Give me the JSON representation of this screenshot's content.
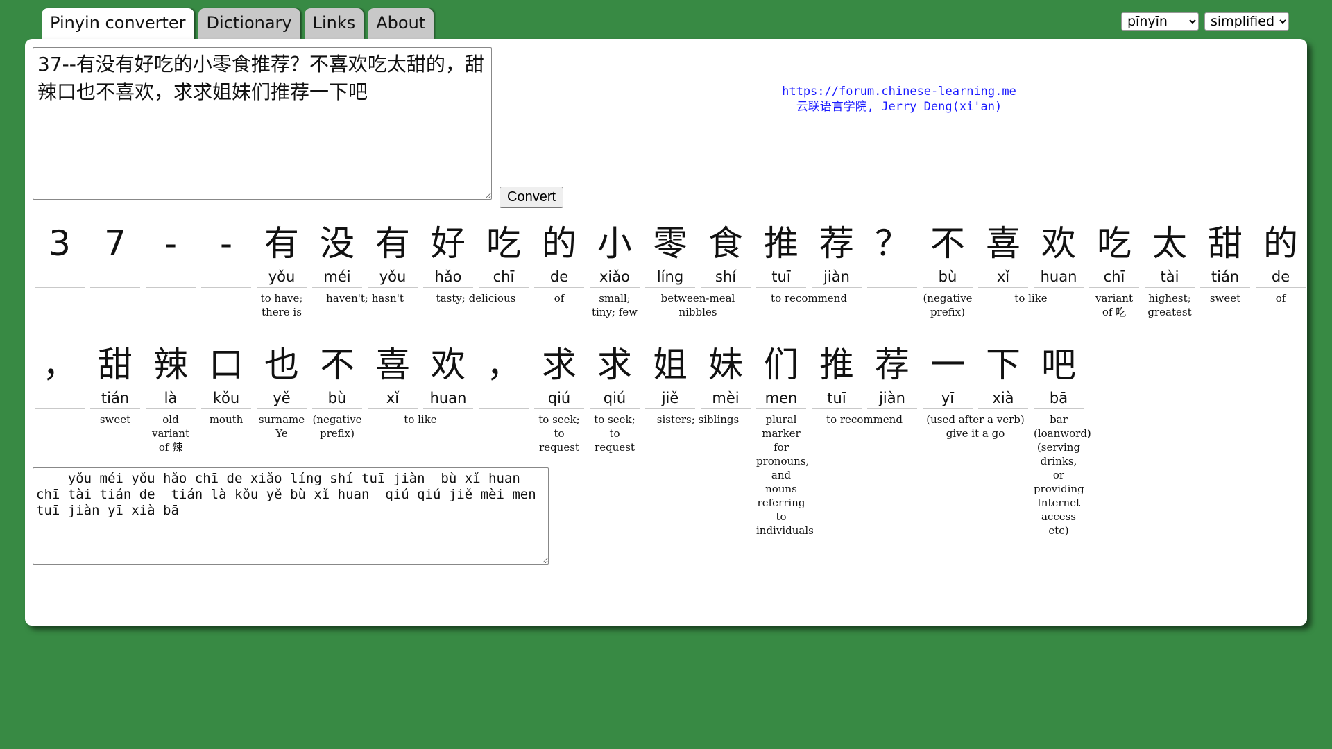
{
  "tabs": [
    {
      "label": "Pinyin converter",
      "active": true
    },
    {
      "label": "Dictionary",
      "active": false
    },
    {
      "label": "Links",
      "active": false
    },
    {
      "label": "About",
      "active": false
    }
  ],
  "selects": {
    "pinyin_mode": "pīnyīn",
    "script": "simplified"
  },
  "input_text": "37--有没有好吃的小零食推荐？不喜欢吃太甜的，甜辣口也不喜欢，求求姐妹们推荐一下吧",
  "convert_label": "Convert",
  "credits": {
    "url": "https://forum.chinese-learning.me",
    "author": "云联语言学院, Jerry Deng(xi'an)"
  },
  "rows": [
    {
      "chars": [
        {
          "h": "3",
          "p": ""
        },
        {
          "h": "7",
          "p": ""
        },
        {
          "h": "-",
          "p": ""
        },
        {
          "h": "-",
          "p": ""
        },
        {
          "h": "有",
          "p": "yǒu"
        },
        {
          "h": "没",
          "p": "méi"
        },
        {
          "h": "有",
          "p": "yǒu"
        },
        {
          "h": "好",
          "p": "hǎo"
        },
        {
          "h": "吃",
          "p": "chī"
        },
        {
          "h": "的",
          "p": "de"
        },
        {
          "h": "小",
          "p": "xiǎo"
        },
        {
          "h": "零",
          "p": "líng"
        },
        {
          "h": "食",
          "p": "shí"
        },
        {
          "h": "推",
          "p": "tuī"
        },
        {
          "h": "荐",
          "p": "jiàn"
        },
        {
          "h": "？",
          "p": ""
        },
        {
          "h": "不",
          "p": "bù"
        },
        {
          "h": "喜",
          "p": "xǐ"
        },
        {
          "h": "欢",
          "p": "huan"
        },
        {
          "h": "吃",
          "p": "chī"
        },
        {
          "h": "太",
          "p": "tài"
        },
        {
          "h": "甜",
          "p": "tián"
        },
        {
          "h": "的",
          "p": "de"
        }
      ],
      "glosses": [
        {
          "start": 4,
          "span": 1,
          "text": "to have; there is"
        },
        {
          "start": 5,
          "span": 2,
          "text": "haven't; hasn't"
        },
        {
          "start": 7,
          "span": 2,
          "text": "tasty; delicious"
        },
        {
          "start": 9,
          "span": 1,
          "text": "of"
        },
        {
          "start": 10,
          "span": 1,
          "text": "small; tiny; few"
        },
        {
          "start": 11,
          "span": 2,
          "text": "between-meal nibbles"
        },
        {
          "start": 13,
          "span": 2,
          "text": "to recommend"
        },
        {
          "start": 16,
          "span": 1,
          "text": "(negative prefix)"
        },
        {
          "start": 17,
          "span": 2,
          "text": "to like"
        },
        {
          "start": 19,
          "span": 1,
          "text": "variant of 吃"
        },
        {
          "start": 20,
          "span": 1,
          "text": "highest; greatest"
        },
        {
          "start": 21,
          "span": 1,
          "text": "sweet"
        },
        {
          "start": 22,
          "span": 1,
          "text": "of"
        }
      ]
    },
    {
      "chars": [
        {
          "h": "，",
          "p": ""
        },
        {
          "h": "甜",
          "p": "tián"
        },
        {
          "h": "辣",
          "p": "là"
        },
        {
          "h": "口",
          "p": "kǒu"
        },
        {
          "h": "也",
          "p": "yě"
        },
        {
          "h": "不",
          "p": "bù"
        },
        {
          "h": "喜",
          "p": "xǐ"
        },
        {
          "h": "欢",
          "p": "huan"
        },
        {
          "h": "，",
          "p": ""
        },
        {
          "h": "求",
          "p": "qiú"
        },
        {
          "h": "求",
          "p": "qiú"
        },
        {
          "h": "姐",
          "p": "jiě"
        },
        {
          "h": "妹",
          "p": "mèi"
        },
        {
          "h": "们",
          "p": "men"
        },
        {
          "h": "推",
          "p": "tuī"
        },
        {
          "h": "荐",
          "p": "jiàn"
        },
        {
          "h": "一",
          "p": "yī"
        },
        {
          "h": "下",
          "p": "xià"
        },
        {
          "h": "吧",
          "p": "bā"
        }
      ],
      "glosses": [
        {
          "start": 1,
          "span": 1,
          "text": "sweet"
        },
        {
          "start": 2,
          "span": 1,
          "text": "old variant of 辣"
        },
        {
          "start": 3,
          "span": 1,
          "text": "mouth"
        },
        {
          "start": 4,
          "span": 1,
          "text": "surname Ye"
        },
        {
          "start": 5,
          "span": 1,
          "text": "(negative prefix)"
        },
        {
          "start": 6,
          "span": 2,
          "text": "to like"
        },
        {
          "start": 9,
          "span": 1,
          "text": "to seek; to request"
        },
        {
          "start": 10,
          "span": 1,
          "text": "to seek; to request"
        },
        {
          "start": 11,
          "span": 2,
          "text": "sisters; siblings"
        },
        {
          "start": 13,
          "span": 1,
          "text": "plural marker for pronouns, and nouns referring to individuals"
        },
        {
          "start": 14,
          "span": 2,
          "text": "to recommend"
        },
        {
          "start": 16,
          "span": 2,
          "text": "(used after a verb) give it a go"
        },
        {
          "start": 18,
          "span": 1,
          "text": "bar (loanword) (serving drinks, or providing Internet access etc)"
        }
      ]
    }
  ],
  "output_text": "    yǒu méi yǒu hǎo chī de xiǎo líng shí tuī jiàn  bù xǐ huan chī tài tián de  tián là kǒu yě bù xǐ huan  qiú qiú jiě mèi men tuī jiàn yī xià bā"
}
